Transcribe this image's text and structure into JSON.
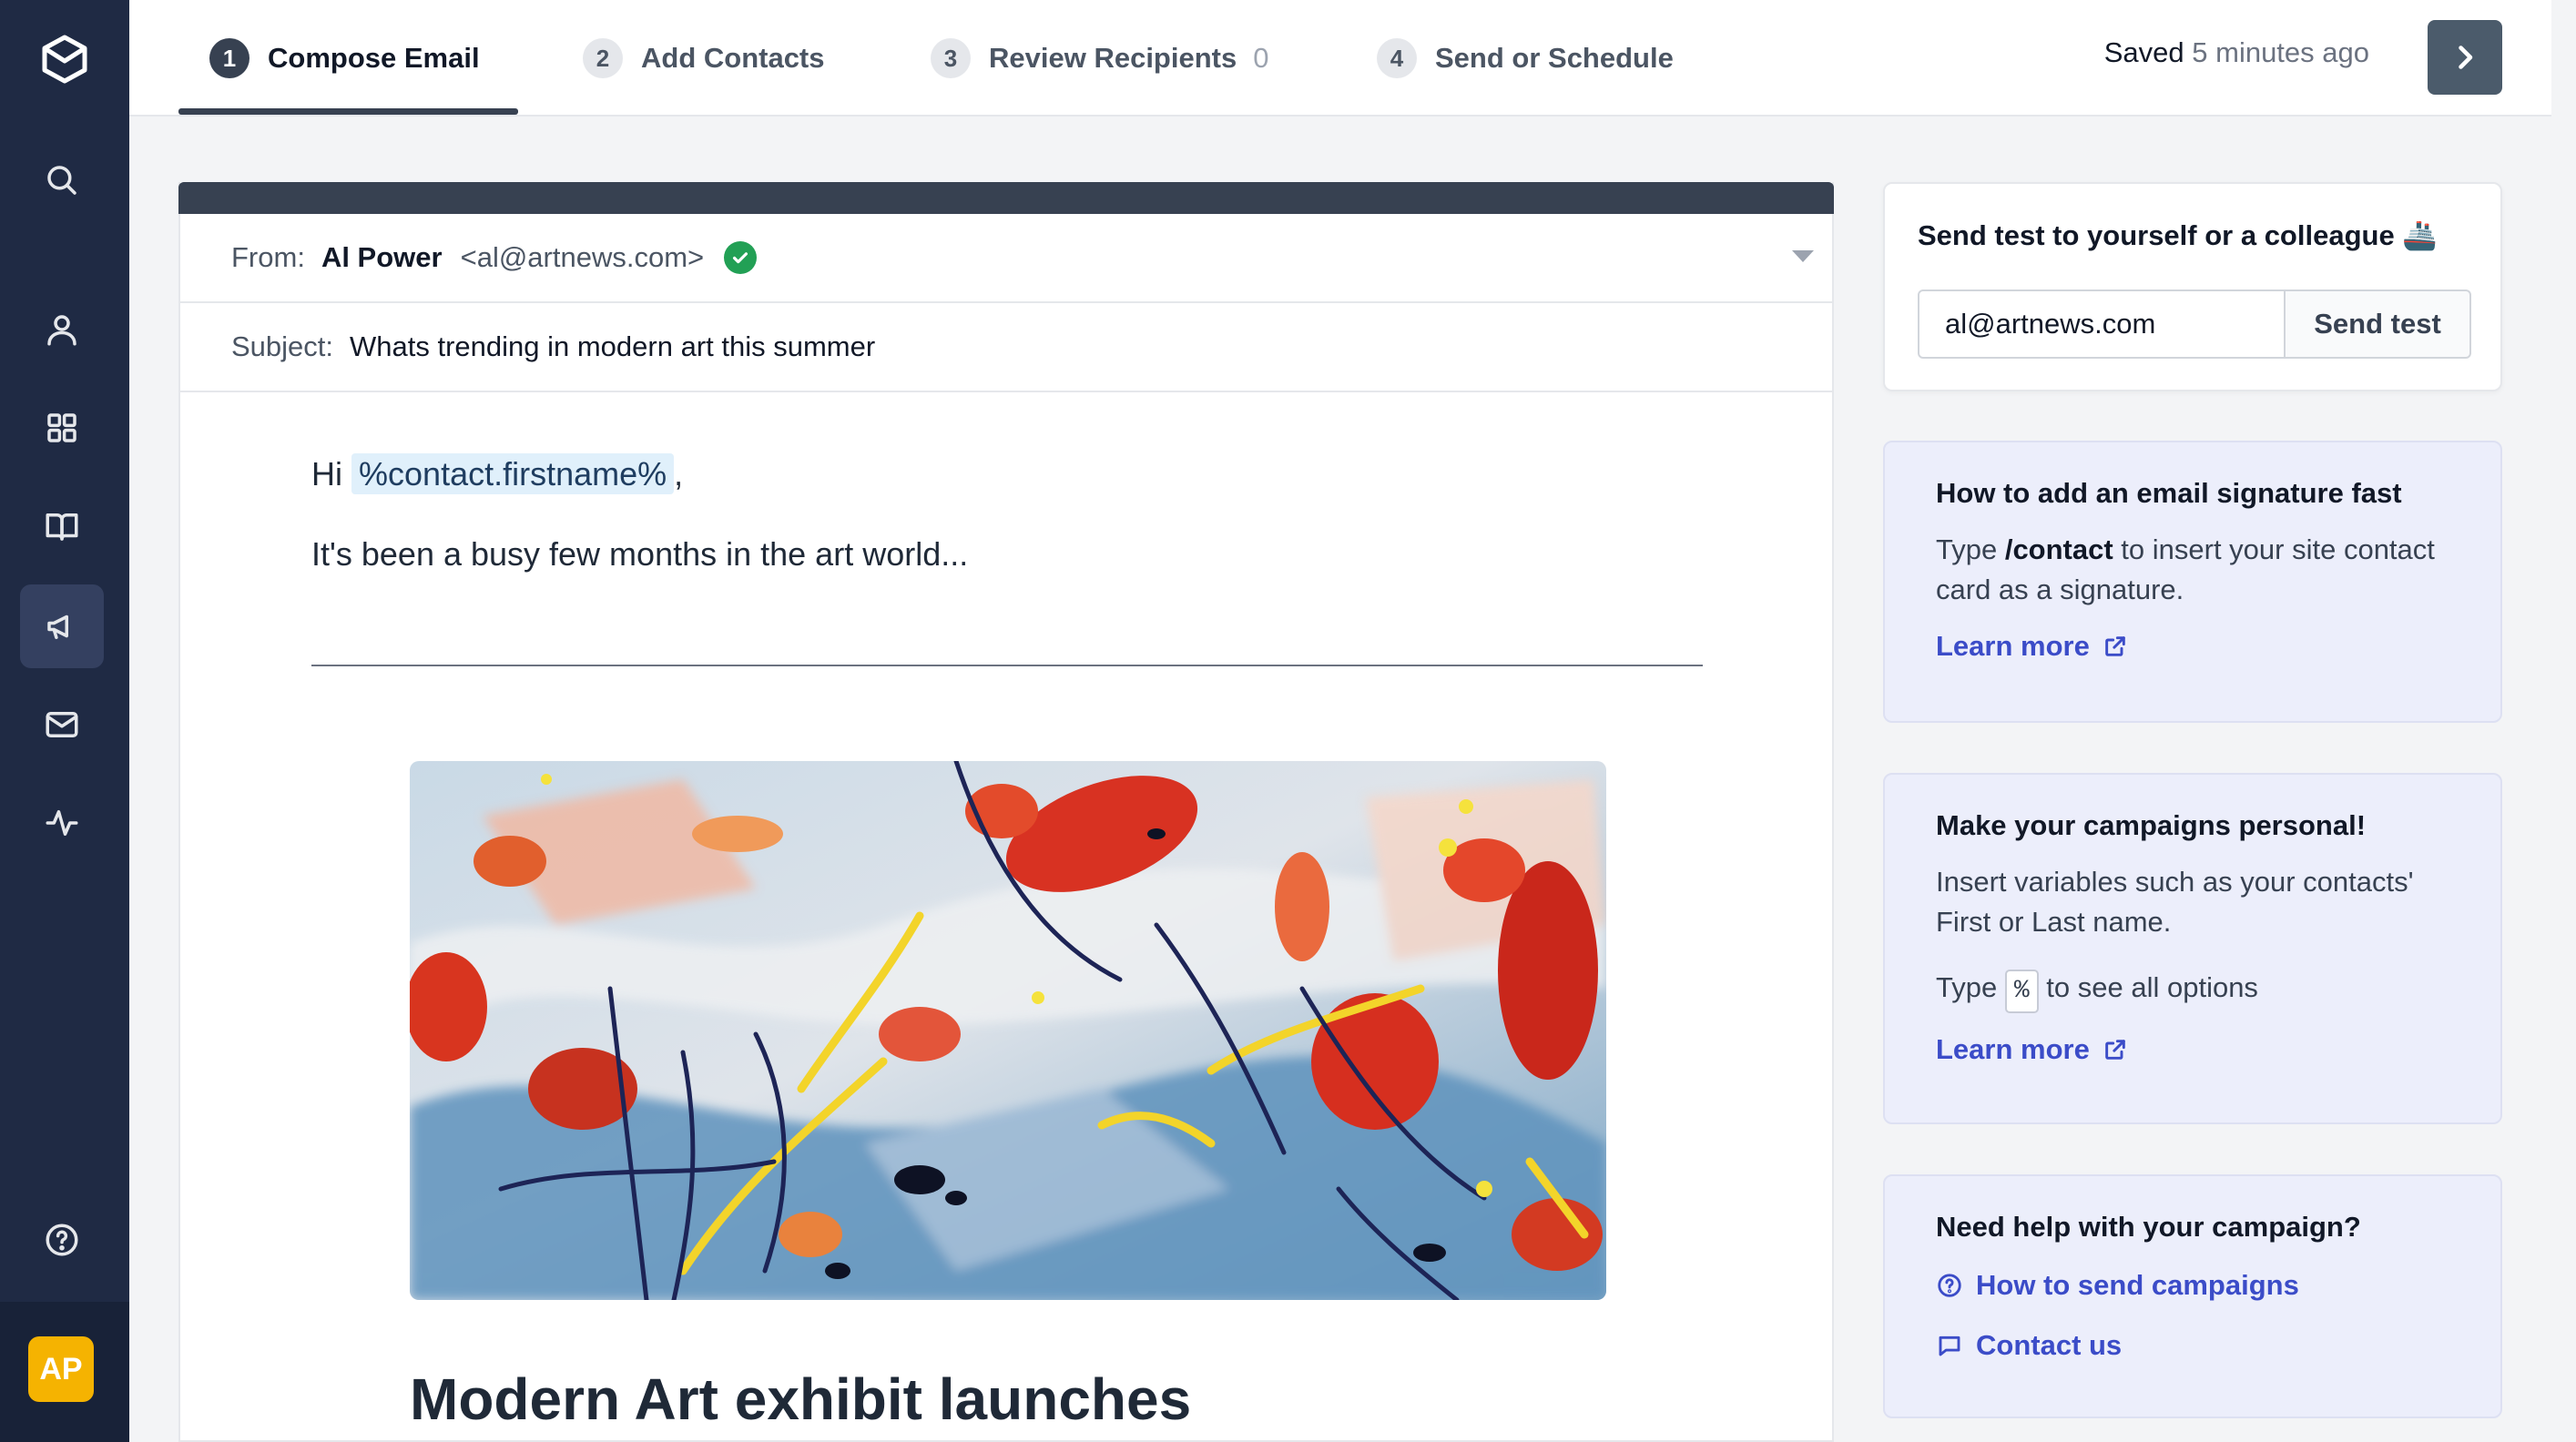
{
  "sidebar": {
    "items": [
      {
        "name": "search",
        "icon": "search-icon"
      },
      {
        "name": "contacts",
        "icon": "user-icon"
      },
      {
        "name": "apps",
        "icon": "grid-icon"
      },
      {
        "name": "library",
        "icon": "book-icon"
      },
      {
        "name": "campaigns",
        "icon": "megaphone-icon",
        "active": true
      },
      {
        "name": "inbox",
        "icon": "mail-icon"
      },
      {
        "name": "activity",
        "icon": "activity-icon"
      },
      {
        "name": "help",
        "icon": "help-icon"
      }
    ],
    "avatar_initials": "AP",
    "avatar_color": "#f5b301"
  },
  "steps": [
    {
      "num": "1",
      "label": "Compose Email",
      "active": true
    },
    {
      "num": "2",
      "label": "Add Contacts"
    },
    {
      "num": "3",
      "label": "Review Recipients",
      "count": "0"
    },
    {
      "num": "4",
      "label": "Send or Schedule"
    }
  ],
  "status": {
    "saved_label": "Saved",
    "saved_time": "5 minutes ago"
  },
  "email": {
    "from_label": "From:",
    "from_name": "Al Power",
    "from_address": "<al@artnews.com>",
    "subject_label": "Subject:",
    "subject": "Whats trending in modern art this summer",
    "greeting": "Hi",
    "variable": "%contact.firstname%",
    "greeting_suffix": ",",
    "intro": "It's been a busy few months in the art world...",
    "headline": "Modern Art exhibit launches"
  },
  "test_panel": {
    "title": "Send test to yourself or a colleague 🚢",
    "email_value": "al@artnews.com",
    "button": "Send test"
  },
  "tip_signature": {
    "title": "How to add an email signature fast",
    "text_pre": "Type ",
    "text_bold": "/contact",
    "text_post": " to insert your site contact card as a signature.",
    "link": "Learn more"
  },
  "tip_personal": {
    "title": "Make your campaigns personal!",
    "text": "Insert variables such as your contacts' First or Last name.",
    "type_pre": "Type",
    "type_chip": "%",
    "type_post": "to see all options",
    "link": "Learn more"
  },
  "help": {
    "title": "Need help with your campaign?",
    "link1": "How to send campaigns",
    "link2": "Contact us"
  },
  "colors": {
    "rail": "#1f2a44",
    "accent_link": "#3b4cc8",
    "verified": "#22a055"
  }
}
